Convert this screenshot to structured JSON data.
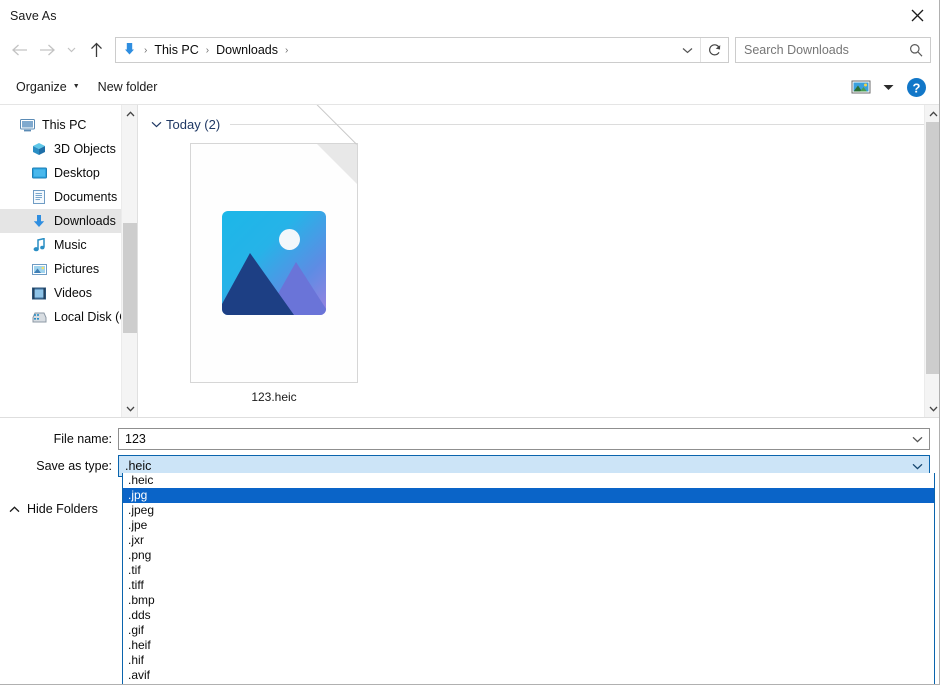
{
  "window": {
    "title": "Save As",
    "close_icon": "close-icon"
  },
  "nav": {
    "back_icon": "arrow-left-icon",
    "forward_icon": "arrow-right-icon",
    "recent_icon": "chevron-down-icon",
    "up_icon": "arrow-up-icon",
    "address_icon": "downloads-arrow-icon",
    "breadcrumbs": [
      "This PC",
      "Downloads"
    ],
    "separator": "›",
    "dropdown_icon": "chevron-down-icon",
    "refresh_icon": "refresh-icon"
  },
  "search": {
    "placeholder": "Search Downloads",
    "value": "",
    "icon": "search-icon"
  },
  "toolbar": {
    "organize_label": "Organize",
    "organize_caret": "▼",
    "new_folder_label": "New folder",
    "view_icon": "view-thumbnails-icon",
    "view_dropdown_icon": "chevron-down-icon",
    "help_icon": "help-icon",
    "help_glyph": "?"
  },
  "sidebar": {
    "items": [
      {
        "label": "This PC",
        "icon": "monitor-icon",
        "level": 0,
        "selected": false
      },
      {
        "label": "3D Objects",
        "icon": "cube-icon",
        "level": 1,
        "selected": false
      },
      {
        "label": "Desktop",
        "icon": "desktop-icon",
        "level": 1,
        "selected": false
      },
      {
        "label": "Documents",
        "icon": "documents-icon",
        "level": 1,
        "selected": false
      },
      {
        "label": "Downloads",
        "icon": "downloads-icon",
        "level": 1,
        "selected": true
      },
      {
        "label": "Music",
        "icon": "music-icon",
        "level": 1,
        "selected": false
      },
      {
        "label": "Pictures",
        "icon": "pictures-icon",
        "level": 1,
        "selected": false
      },
      {
        "label": "Videos",
        "icon": "videos-icon",
        "level": 1,
        "selected": false
      },
      {
        "label": "Local Disk (C:)",
        "icon": "harddisk-icon",
        "level": 1,
        "selected": false
      }
    ],
    "scroll_up_icon": "chevron-up-icon",
    "scroll_down_icon": "chevron-down-icon"
  },
  "filepane": {
    "group_label": "Today (2)",
    "group_chevron_icon": "chevron-down-icon",
    "files": [
      {
        "name": "123.heic",
        "icon": "photo-file-icon"
      }
    ],
    "scroll_up_icon": "chevron-up-icon",
    "scroll_down_icon": "chevron-down-icon"
  },
  "form": {
    "file_name_label": "File name:",
    "file_name_value": "123",
    "save_as_type_label": "Save as type:",
    "save_as_type_value": ".heic",
    "combo_arrow_icon": "chevron-down-icon",
    "hide_folders_label": "Hide Folders",
    "hide_folders_icon": "chevron-up-icon"
  },
  "dropdown": {
    "open": true,
    "selected_index": 1,
    "options": [
      ".heic",
      ".jpg",
      ".jpeg",
      ".jpe",
      ".jxr",
      ".png",
      ".tif",
      ".tiff",
      ".bmp",
      ".dds",
      ".gif",
      ".heif",
      ".hif",
      ".avif"
    ]
  },
  "colors": {
    "accent": "#0a64c8",
    "combo_highlight_bg": "#cce4f7",
    "combo_highlight_border": "#0a64ad",
    "selection_bg": "#e5e5e5",
    "group_label": "#1f3864",
    "downloads_blue": "#2f8ee0"
  }
}
